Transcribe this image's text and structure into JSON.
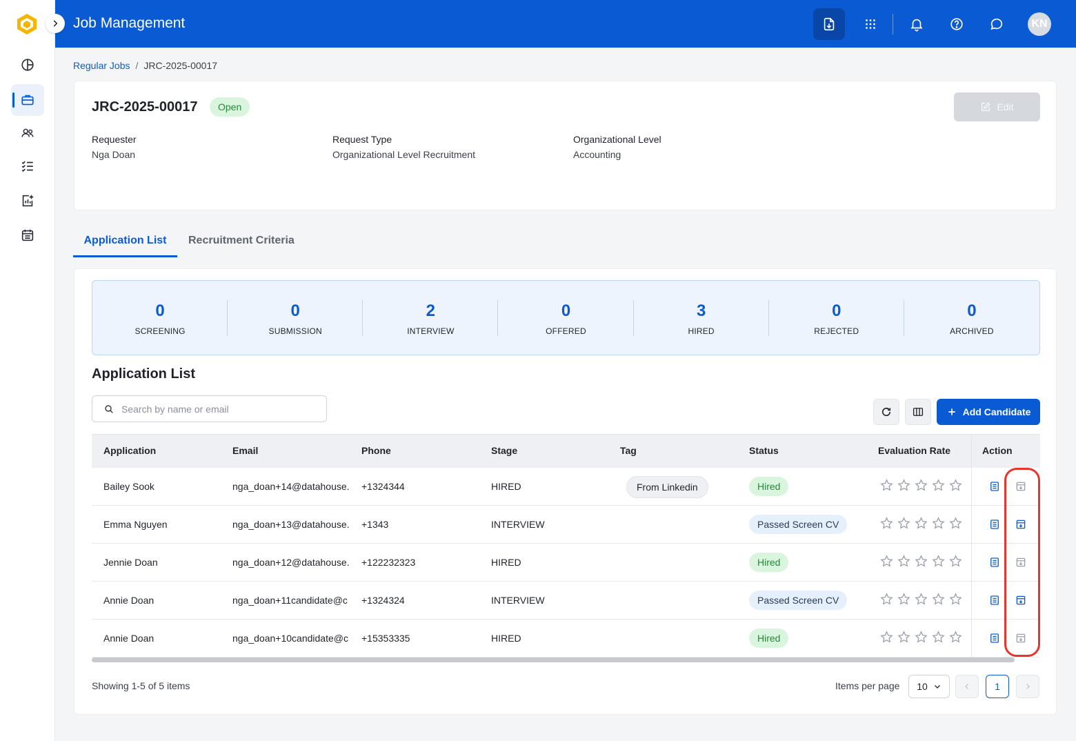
{
  "app": {
    "title": "Job Management",
    "avatar_initials": "KN",
    "accent_color": "#0a5bd3"
  },
  "sidebar": {
    "items": [
      {
        "icon": "pie-chart-icon",
        "active": false
      },
      {
        "icon": "briefcase-icon",
        "active": true
      },
      {
        "icon": "users-icon",
        "active": false
      },
      {
        "icon": "checklist-icon",
        "active": false
      },
      {
        "icon": "report-add-icon",
        "active": false
      },
      {
        "icon": "calendar-icon",
        "active": false
      }
    ]
  },
  "header_icons": [
    "download-file-icon",
    "apps-grid-icon",
    "bell-icon",
    "help-icon",
    "chat-icon"
  ],
  "breadcrumb": {
    "parent": "Regular Jobs",
    "separator": "/",
    "current": "JRC-2025-00017"
  },
  "job": {
    "id": "JRC-2025-00017",
    "status": "Open",
    "edit_label": "Edit",
    "fields": [
      {
        "label": "Requester",
        "value": "Nga Doan"
      },
      {
        "label": "Request Type",
        "value": "Organizational Level Recruitment"
      },
      {
        "label": "Organizational Level",
        "value": "Accounting"
      }
    ]
  },
  "tabs": [
    {
      "label": "Application List",
      "active": true
    },
    {
      "label": "Recruitment Criteria",
      "active": false
    }
  ],
  "stats": [
    {
      "value": "0",
      "label": "SCREENING"
    },
    {
      "value": "0",
      "label": "SUBMISSION"
    },
    {
      "value": "2",
      "label": "INTERVIEW"
    },
    {
      "value": "0",
      "label": "OFFERED"
    },
    {
      "value": "3",
      "label": "HIRED"
    },
    {
      "value": "0",
      "label": "REJECTED"
    },
    {
      "value": "0",
      "label": "ARCHIVED"
    }
  ],
  "list": {
    "title": "Application List",
    "search_placeholder": "Search by name or email",
    "add_label": "Add Candidate",
    "columns": [
      "Application",
      "Email",
      "Phone",
      "Stage",
      "Tag",
      "Status",
      "Evaluation Rate",
      "Action"
    ],
    "rows": [
      {
        "name": "Bailey Sook",
        "email": "nga_doan+14@datahouse.",
        "phone": "+1324344",
        "stage": "HIRED",
        "tag": "From Linkedin",
        "status": "Hired",
        "status_kind": "hired",
        "rating": 0,
        "archive_enabled": false
      },
      {
        "name": "Emma Nguyen",
        "email": "nga_doan+13@datahouse.",
        "phone": "+1343",
        "stage": "INTERVIEW",
        "tag": "",
        "status": "Passed Screen CV",
        "status_kind": "passed",
        "rating": 0,
        "archive_enabled": true
      },
      {
        "name": "Jennie Doan",
        "email": "nga_doan+12@datahouse.",
        "phone": "+122232323",
        "stage": "HIRED",
        "tag": "",
        "status": "Hired",
        "status_kind": "hired",
        "rating": 0,
        "archive_enabled": false
      },
      {
        "name": "Annie Doan",
        "email": "nga_doan+11candidate@c",
        "phone": "+1324324",
        "stage": "INTERVIEW",
        "tag": "",
        "status": "Passed Screen CV",
        "status_kind": "passed",
        "rating": 0,
        "archive_enabled": true
      },
      {
        "name": "Annie Doan",
        "email": "nga_doan+10candidate@c",
        "phone": "+15353335",
        "stage": "HIRED",
        "tag": "",
        "status": "Hired",
        "status_kind": "hired",
        "rating": 0,
        "archive_enabled": false
      }
    ]
  },
  "pagination": {
    "showing": "Showing 1-5 of 5 items",
    "items_per_page_label": "Items per page",
    "items_per_page": "10",
    "current_page": "1"
  },
  "colors": {
    "hired_bg": "#daf5de",
    "hired_text": "#1e8b35",
    "passed_bg": "#e6f0fc",
    "highlight": "#e8342a"
  }
}
